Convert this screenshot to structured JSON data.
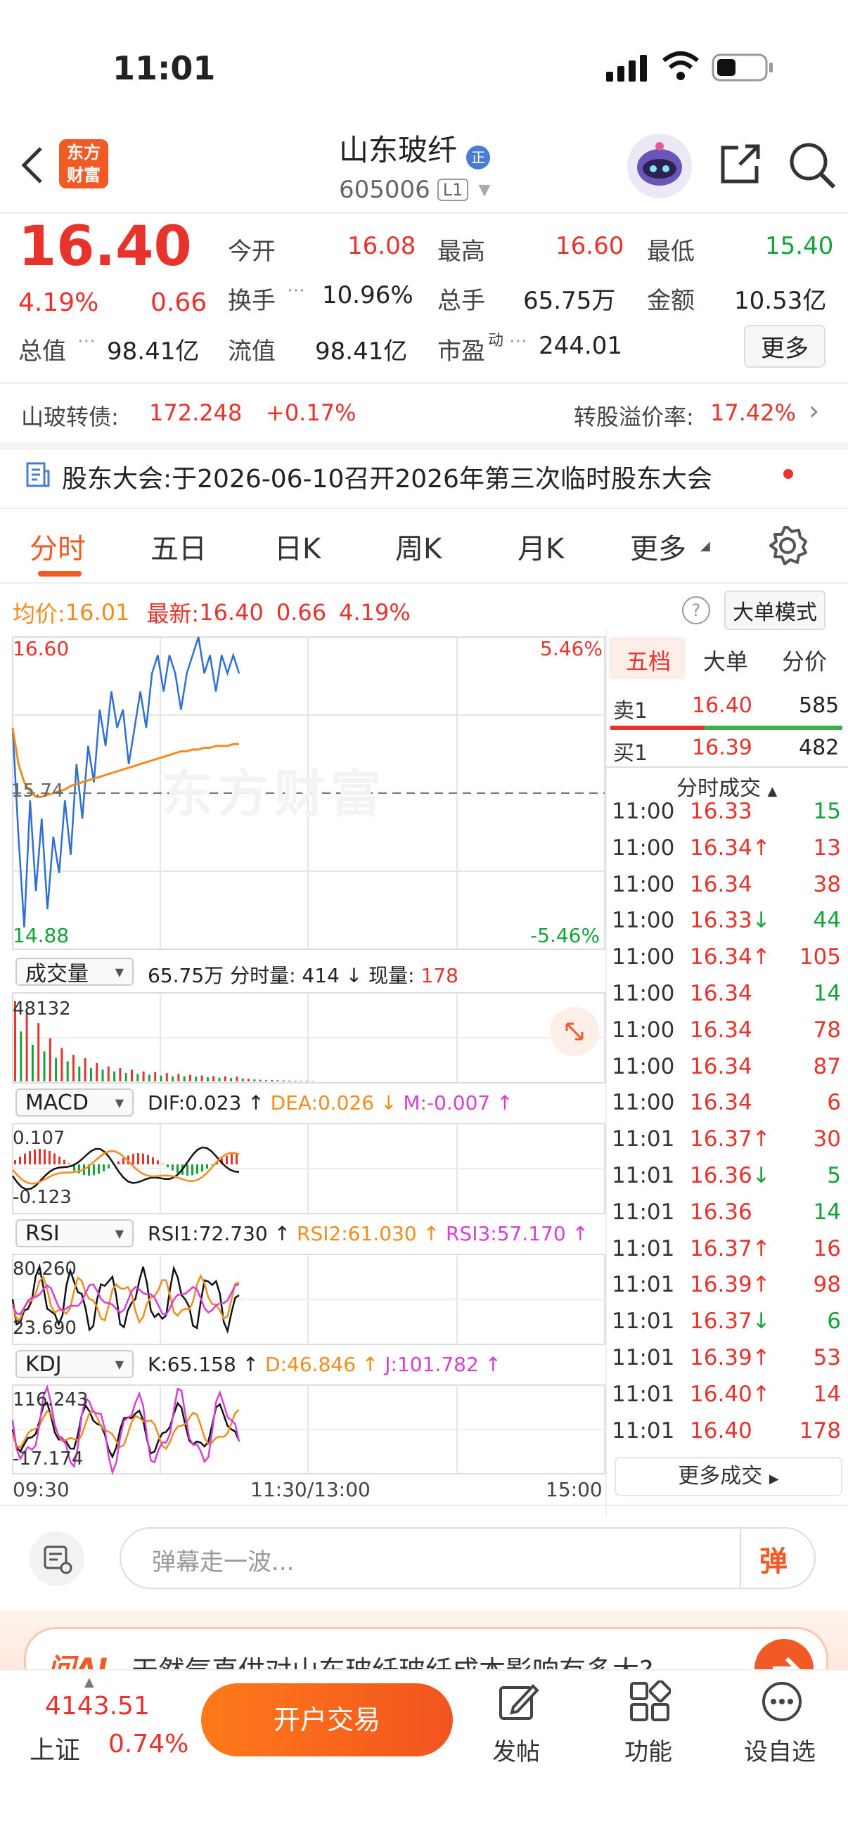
{
  "status_bar": {
    "time": "11:01"
  },
  "header": {
    "logo_line1": "东方",
    "logo_line2": "财富",
    "title": "山东玻纤",
    "badge": "正",
    "code": "605006",
    "level": "L1"
  },
  "quote": {
    "price": "16.40",
    "change_pct": "4.19%",
    "change": "0.66",
    "fields": [
      {
        "label": "今开",
        "value": "16.08",
        "color": "red"
      },
      {
        "label": "最高",
        "value": "16.60",
        "color": "red"
      },
      {
        "label": "最低",
        "value": "15.40",
        "color": "green"
      },
      {
        "label": "换手",
        "value": "10.96%",
        "color": "black"
      },
      {
        "label": "总手",
        "value": "65.75万",
        "color": "black"
      },
      {
        "label": "金额",
        "value": "10.53亿",
        "color": "black"
      },
      {
        "label": "总值",
        "value": "98.41亿",
        "color": "black"
      },
      {
        "label": "流值",
        "value": "98.41亿",
        "color": "black"
      },
      {
        "label": "市盈",
        "value": "244.01",
        "color": "black"
      }
    ],
    "pe_sup": "动",
    "more_label": "更多"
  },
  "bond": {
    "label": "山玻转债:",
    "price": "172.248",
    "change": "+0.17%",
    "premium_label": "转股溢价率:",
    "premium": "17.42%"
  },
  "notice": {
    "text": "股东大会:于2026-06-10召开2026年第三次临时股东大会"
  },
  "tabs": [
    "分时",
    "五日",
    "日K",
    "周K",
    "月K",
    "更多"
  ],
  "avg_bar": {
    "avg_label": "均价:",
    "avg": "16.01",
    "latest_label": "最新:",
    "latest": "16.40",
    "change": "0.66",
    "change_pct": "4.19%",
    "mode_label": "大单模式"
  },
  "chart_data": {
    "type": "line",
    "y_max_label": "16.60",
    "y_min_label": "14.88",
    "y_mid_label": "15.74",
    "pct_max": "5.46%",
    "pct_min": "-5.46%",
    "x_labels": [
      "09:30",
      "11:30/13:00",
      "15:00"
    ],
    "watermark": "东方财富",
    "ylim": [
      14.88,
      16.6
    ],
    "series": [
      {
        "name": "最新",
        "color": "#2f6fd1",
        "values": [
          16.1,
          15.5,
          15.0,
          15.7,
          15.2,
          15.6,
          15.1,
          15.5,
          15.3,
          15.7,
          15.4,
          15.9,
          15.6,
          16.0,
          15.8,
          16.2,
          16.0,
          16.3,
          16.1,
          16.2,
          15.9,
          16.1,
          16.3,
          16.1,
          16.4,
          16.5,
          16.3,
          16.5,
          16.4,
          16.2,
          16.4,
          16.5,
          16.6,
          16.4,
          16.5,
          16.3,
          16.5,
          16.4,
          16.5,
          16.4
        ]
      },
      {
        "name": "均价",
        "color": "#f28c1c",
        "values": [
          16.1,
          15.9,
          15.8,
          15.75,
          15.72,
          15.72,
          15.73,
          15.74,
          15.75,
          15.76,
          15.78,
          15.79,
          15.8,
          15.81,
          15.82,
          15.83,
          15.84,
          15.85,
          15.86,
          15.87,
          15.88,
          15.89,
          15.9,
          15.91,
          15.92,
          15.93,
          15.94,
          15.95,
          15.96,
          15.97,
          15.97,
          15.98,
          15.98,
          15.99,
          15.99,
          16.0,
          16.0,
          16.0,
          16.01,
          16.01
        ]
      }
    ]
  },
  "volume": {
    "select": "成交量",
    "total": "65.75万",
    "minute_label": "分时量:",
    "minute": "414",
    "current_label": "现量:",
    "current": "178",
    "max_label": "48132",
    "values": [
      48132,
      30000,
      41000,
      22000,
      35000,
      18000,
      26000,
      14000,
      20000,
      12000,
      16000,
      9000,
      14000,
      8000,
      11000,
      7000,
      9000,
      6000,
      8000,
      5000,
      7000,
      4500,
      6000,
      4000,
      5500,
      3500,
      5000,
      3000,
      4500,
      3000,
      4000,
      2800,
      3500,
      2500,
      3200,
      2200,
      3000,
      2000,
      2800,
      1800
    ]
  },
  "macd": {
    "select": "MACD",
    "dif": "DIF:0.023",
    "dea": "DEA:0.026",
    "m": "M:-0.007",
    "top_label": "0.107",
    "bottom_label": "-0.123"
  },
  "rsi": {
    "select": "RSI",
    "rsi1": "RSI1:72.730",
    "rsi2": "RSI2:61.030",
    "rsi3": "RSI3:57.170",
    "top_label": "80.260",
    "bottom_label": "23.690"
  },
  "kdj": {
    "select": "KDJ",
    "k": "K:65.158",
    "d": "D:46.846",
    "j": "J:101.782",
    "top_label": "116.243",
    "bottom_label": "-17.174"
  },
  "order_book": {
    "tabs": [
      "五档",
      "大单",
      "分价"
    ],
    "sell1": {
      "label": "卖1",
      "price": "16.40",
      "vol": "585"
    },
    "buy1": {
      "label": "买1",
      "price": "16.39",
      "vol": "482"
    },
    "trades_title": "分时成交",
    "trades": [
      {
        "time": "11:00",
        "price": "16.33",
        "arrow": "",
        "vol": "15",
        "color": "red",
        "vcolor": "green"
      },
      {
        "time": "11:00",
        "price": "16.34",
        "arrow": "↑",
        "vol": "13",
        "color": "red",
        "vcolor": "red"
      },
      {
        "time": "11:00",
        "price": "16.34",
        "arrow": "",
        "vol": "38",
        "color": "red",
        "vcolor": "red"
      },
      {
        "time": "11:00",
        "price": "16.33",
        "arrow": "↓",
        "vol": "44",
        "color": "red",
        "vcolor": "green"
      },
      {
        "time": "11:00",
        "price": "16.34",
        "arrow": "↑",
        "vol": "105",
        "color": "red",
        "vcolor": "red"
      },
      {
        "time": "11:00",
        "price": "16.34",
        "arrow": "",
        "vol": "14",
        "color": "red",
        "vcolor": "green"
      },
      {
        "time": "11:00",
        "price": "16.34",
        "arrow": "",
        "vol": "78",
        "color": "red",
        "vcolor": "red"
      },
      {
        "time": "11:00",
        "price": "16.34",
        "arrow": "",
        "vol": "87",
        "color": "red",
        "vcolor": "red"
      },
      {
        "time": "11:00",
        "price": "16.34",
        "arrow": "",
        "vol": "6",
        "color": "red",
        "vcolor": "red"
      },
      {
        "time": "11:01",
        "price": "16.37",
        "arrow": "↑",
        "vol": "30",
        "color": "red",
        "vcolor": "red"
      },
      {
        "time": "11:01",
        "price": "16.36",
        "arrow": "↓",
        "vol": "5",
        "color": "red",
        "vcolor": "green"
      },
      {
        "time": "11:01",
        "price": "16.36",
        "arrow": "",
        "vol": "14",
        "color": "red",
        "vcolor": "green"
      },
      {
        "time": "11:01",
        "price": "16.37",
        "arrow": "↑",
        "vol": "16",
        "color": "red",
        "vcolor": "red"
      },
      {
        "time": "11:01",
        "price": "16.39",
        "arrow": "↑",
        "vol": "98",
        "color": "red",
        "vcolor": "red"
      },
      {
        "time": "11:01",
        "price": "16.37",
        "arrow": "↓",
        "vol": "6",
        "color": "red",
        "vcolor": "green"
      },
      {
        "time": "11:01",
        "price": "16.39",
        "arrow": "↑",
        "vol": "53",
        "color": "red",
        "vcolor": "red"
      },
      {
        "time": "11:01",
        "price": "16.40",
        "arrow": "↑",
        "vol": "14",
        "color": "red",
        "vcolor": "red"
      },
      {
        "time": "11:01",
        "price": "16.40",
        "arrow": "",
        "vol": "178",
        "color": "red",
        "vcolor": "red"
      }
    ],
    "more_label": "更多成交"
  },
  "comment": {
    "placeholder": "弹幕走一波...",
    "danmu_label": "弹"
  },
  "ai_banner": {
    "brand": "问AI",
    "text": "天然气直供对山东玻纤玻纤成本影响有多大?"
  },
  "bottom": {
    "index_value": "4143.51",
    "index_name": "上证",
    "index_change": "0.74%",
    "trade_button": "开户交易",
    "nav": [
      {
        "label": "发帖",
        "icon": "edit-icon"
      },
      {
        "label": "功能",
        "icon": "grid-icon"
      },
      {
        "label": "设自选",
        "icon": "more-icon"
      }
    ]
  }
}
